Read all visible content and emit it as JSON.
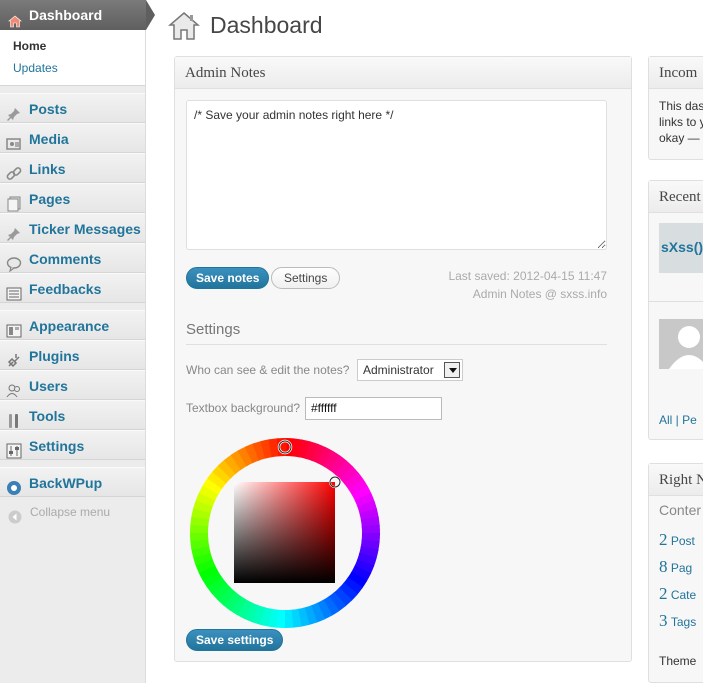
{
  "sidebar": {
    "dashboard": "Dashboard",
    "submenu": [
      "Home",
      "Updates"
    ],
    "group1": [
      "Posts",
      "Media",
      "Links",
      "Pages",
      "Ticker Messages",
      "Comments",
      "Feedbacks"
    ],
    "group2": [
      "Appearance",
      "Plugins",
      "Users",
      "Tools",
      "Settings"
    ],
    "group3": [
      "BackWPup"
    ],
    "collapse": "Collapse menu"
  },
  "page": {
    "title": "Dashboard"
  },
  "admin_notes": {
    "title": "Admin Notes",
    "text": "/* Save your admin notes right here */",
    "save_label": "Save notes",
    "settings_label": "Settings",
    "last_saved": "Last saved: 2012-04-15 11:47",
    "credit": "Admin Notes @ sxss.info",
    "settings_heading": "Settings",
    "who_label": "Who can see & edit the notes?",
    "who_value": "Administrator",
    "bg_label": "Textbox background?",
    "bg_value": "#ffffff",
    "save_settings_label": "Save settings"
  },
  "right": {
    "incoming_title": "Incom",
    "incoming_lines": [
      "This das",
      "links to y",
      "okay — "
    ],
    "recent_title": "Recent",
    "recent_thumb": "sXss()",
    "recent_links": "All | Pe",
    "right_now_title": "Right N",
    "content_label": "Conter",
    "counts": [
      "2",
      "8",
      "2",
      "3"
    ],
    "count_labels": [
      "Post",
      "Pag",
      "Cate",
      "Tags"
    ],
    "theme_text": "Theme"
  },
  "colors": {
    "accent": "#21759b",
    "sidebar_bg": "#ececec",
    "panel_bg": "#f7f7f7"
  }
}
